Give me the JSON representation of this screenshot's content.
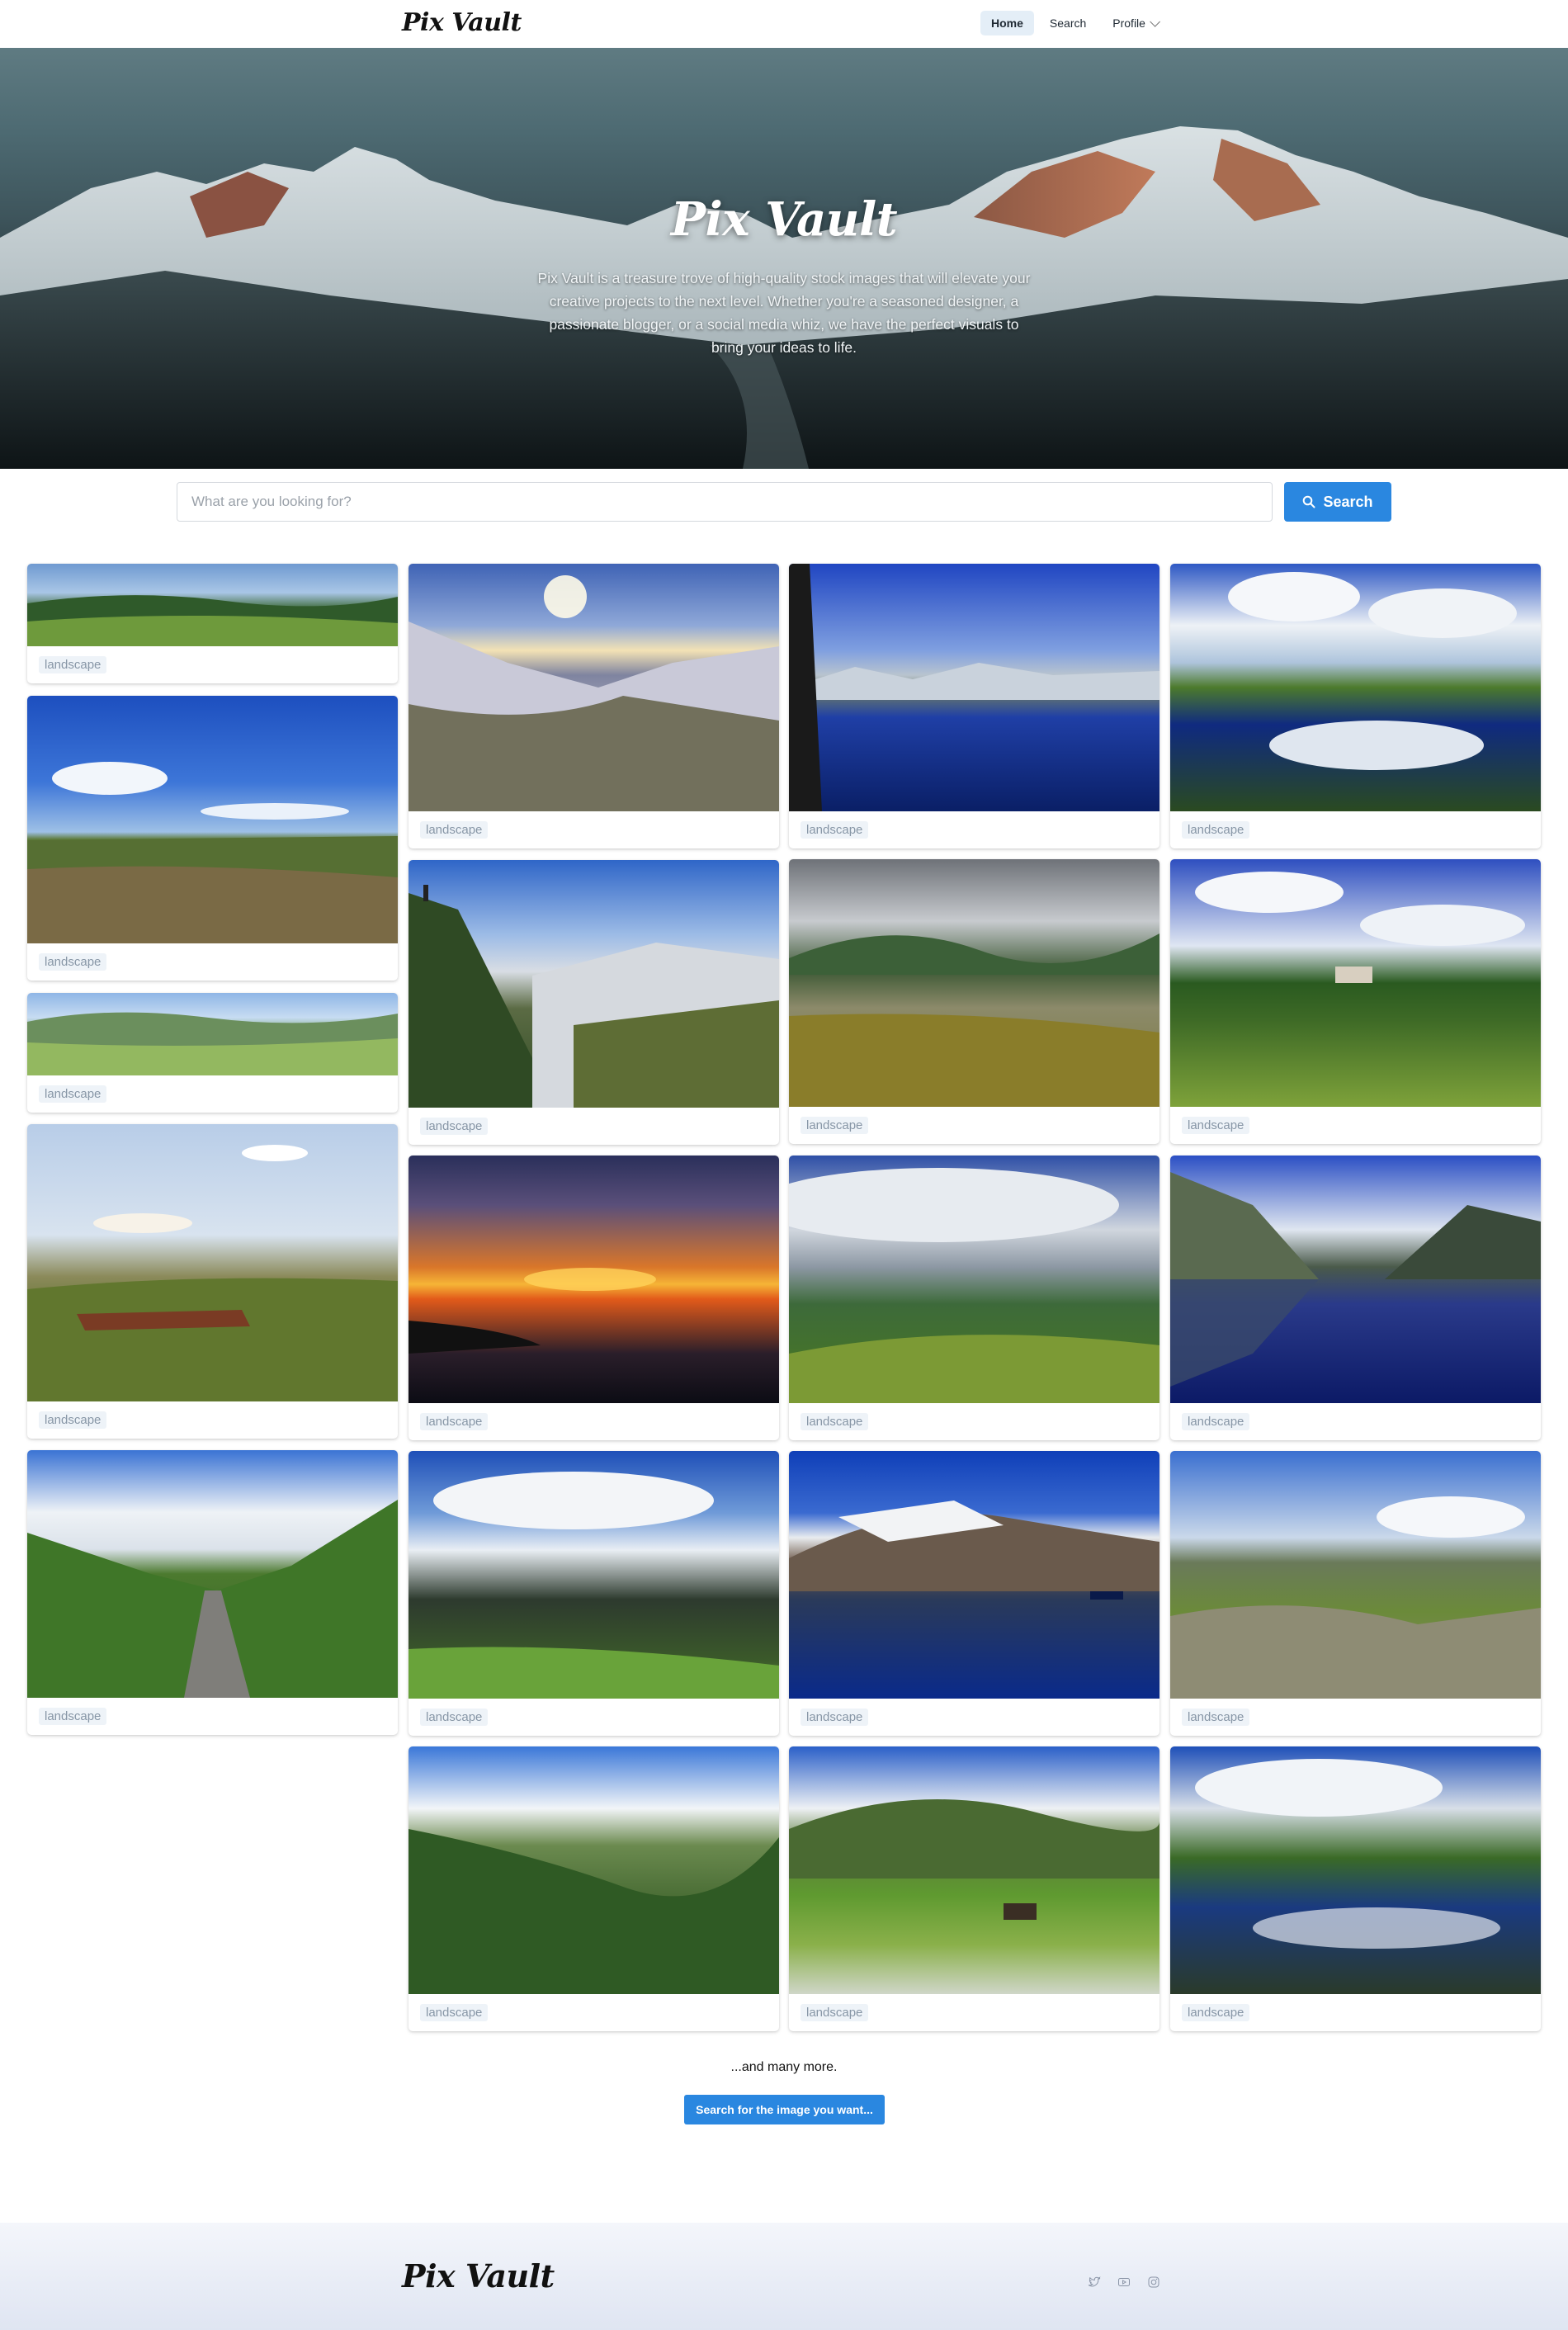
{
  "header": {
    "logo": "Pix Vault",
    "nav": [
      {
        "label": "Home",
        "active": true
      },
      {
        "label": "Search",
        "active": false
      },
      {
        "label": "Profile",
        "active": false
      }
    ]
  },
  "hero": {
    "title": "Pix Vault",
    "description": "Pix Vault is a treasure trove of high-quality stock images that will elevate your creative projects to the next level. Whether you're a seasoned designer, a passionate blogger, or a social media whiz, we have the perfect visuals to bring your ideas to life."
  },
  "search": {
    "placeholder": "What are you looking for?",
    "value": "",
    "button_label": "Search",
    "button_icon": "search-icon"
  },
  "gallery": {
    "tag": "landscape",
    "images": [
      {
        "tag": "landscape",
        "scene": "wide green moorland panorama"
      },
      {
        "tag": "landscape",
        "scene": "open grassland under blue sky"
      },
      {
        "tag": "landscape",
        "scene": "green valley panorama"
      },
      {
        "tag": "landscape",
        "scene": "heathland with scattered clouds"
      },
      {
        "tag": "landscape",
        "scene": "country lane through green valley"
      },
      {
        "tag": "landscape",
        "scene": "snowy mountain valley with sun"
      },
      {
        "tag": "landscape",
        "scene": "hiker on snowy ridge"
      },
      {
        "tag": "landscape",
        "scene": "sunset over lake"
      },
      {
        "tag": "landscape",
        "scene": "view over green plains"
      },
      {
        "tag": "landscape",
        "scene": "green hills valley"
      },
      {
        "tag": "landscape",
        "scene": "alpine lake with village"
      },
      {
        "tag": "landscape",
        "scene": "tidal flats under grey clouds"
      },
      {
        "tag": "landscape",
        "scene": "hills under cloudy sky"
      },
      {
        "tag": "landscape",
        "scene": "snowy peak reflected in lake with boat"
      },
      {
        "tag": "landscape",
        "scene": "farmland with stone walls"
      },
      {
        "tag": "landscape",
        "scene": "marsh pools reflecting clouds"
      },
      {
        "tag": "landscape",
        "scene": "meadow with forest and village"
      },
      {
        "tag": "landscape",
        "scene": "mountain lake reflection"
      },
      {
        "tag": "landscape",
        "scene": "rocky moorland view"
      },
      {
        "tag": "landscape",
        "scene": "pond with trees and clouds"
      }
    ]
  },
  "more": {
    "text": "...and many more.",
    "button_label": "Search for the image you want..."
  },
  "footer": {
    "logo": "Pix Vault",
    "social": [
      {
        "icon": "twitter-icon"
      },
      {
        "icon": "youtube-icon"
      },
      {
        "icon": "instagram-icon"
      }
    ]
  }
}
